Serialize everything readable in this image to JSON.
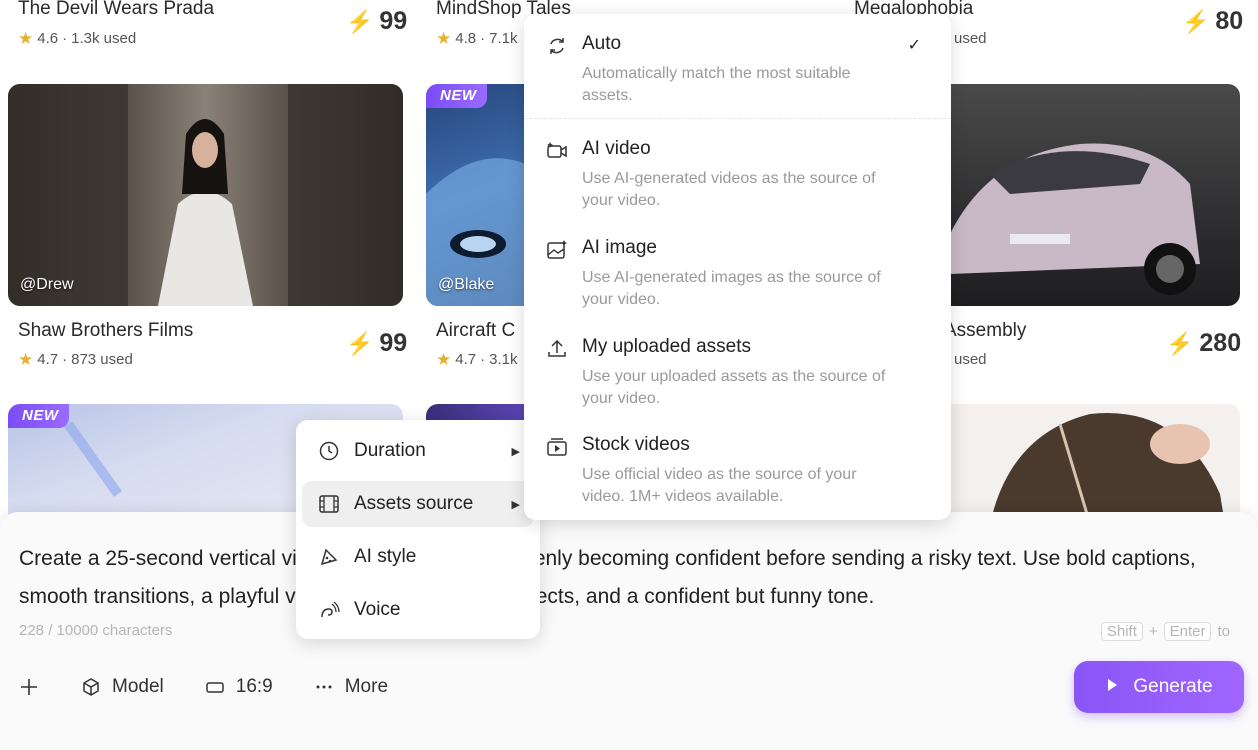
{
  "cards": [
    {
      "id": "c1",
      "title": "The Devil Wears Prada",
      "rating": "4.6",
      "used": "1.3k used",
      "cost": "99"
    },
    {
      "id": "c2",
      "title": "MindShop Tales",
      "rating": "4.8",
      "used": "7.1k"
    },
    {
      "id": "c3",
      "title": "Megalophobia",
      "used": "used",
      "cost": "80"
    },
    {
      "id": "c4",
      "title": "Shaw Brothers Films",
      "rating": "4.7",
      "used": "873 used",
      "cost": "99",
      "author": "@Drew"
    },
    {
      "id": "c5",
      "title": "Aircraft C",
      "rating": "4.7",
      "used": "3.1k",
      "author": "@Blake",
      "badge": "NEW"
    },
    {
      "id": "c6",
      "title": "Assembly",
      "used": "used",
      "cost": "280"
    },
    {
      "id": "c7",
      "badge": "NEW"
    }
  ],
  "composer": {
    "prompt": "Create a 25-second vertical video about someone suddenly becoming confident before sending a risky text. Use bold captions, smooth transitions, a playful voiceover, meme sound effects, and a confident but funny tone.",
    "char_count": "228 / 10000 characters",
    "shortcut": {
      "key1": "Shift",
      "plus": "+",
      "key2": "Enter",
      "suffix": "to"
    },
    "toolbar": {
      "model": "Model",
      "ratio": "16:9",
      "more": "More"
    },
    "generate_label": "Generate"
  },
  "more_menu": {
    "items": [
      {
        "label": "Duration",
        "icon": "clock-icon"
      },
      {
        "label": "Assets source",
        "icon": "film-icon",
        "active": true
      },
      {
        "label": "AI style",
        "icon": "palette-icon"
      },
      {
        "label": "Voice",
        "icon": "voice-icon"
      }
    ]
  },
  "assets_menu": {
    "items": [
      {
        "title": "Auto",
        "desc": "Automatically match the most suitable assets.",
        "icon": "refresh-icon",
        "selected": true
      },
      {
        "title": "AI video",
        "desc": "Use AI-generated videos as the source of your video.",
        "icon": "ai-video-icon"
      },
      {
        "title": "AI image",
        "desc": "Use AI-generated images as the source of your video.",
        "icon": "ai-image-icon"
      },
      {
        "title": "My uploaded assets",
        "desc": "Use your uploaded assets as the source of your video.",
        "icon": "upload-icon"
      },
      {
        "title": "Stock videos",
        "desc": "Use official video as the source of your video. 1M+ videos available.",
        "icon": "stock-video-icon"
      }
    ]
  },
  "colors": {
    "accent": "#8a55f7",
    "star": "#e6b12e",
    "bolt": "#e8b53a"
  }
}
